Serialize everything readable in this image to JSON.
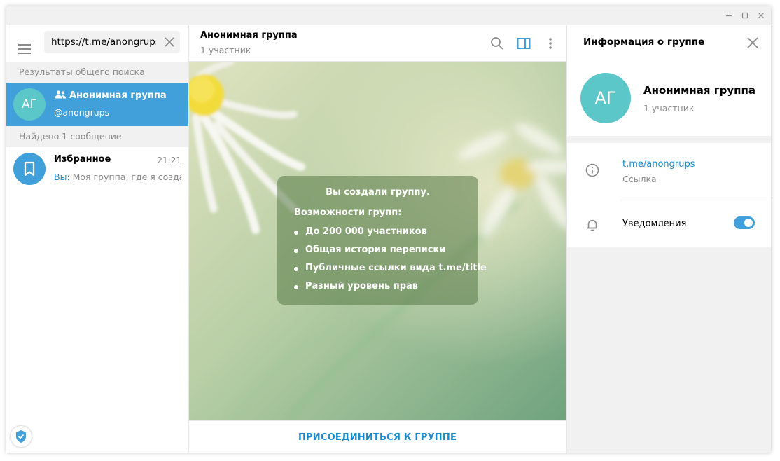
{
  "window": {
    "controls": [
      "minimize-icon",
      "maximize-icon",
      "close-icon"
    ]
  },
  "sidebar": {
    "search_value": "https://t.me/anongrups",
    "global_results_header": "Результаты общего поиска",
    "found_messages_header": "Найдено 1 сообщение",
    "results": [
      {
        "avatar_initials": "АГ",
        "avatar_color": "#5bc7c9",
        "name": "Анонимная группа",
        "username": "@anongrups",
        "icon": "group-icon"
      }
    ],
    "messages": [
      {
        "name": "Избранное",
        "time": "21:21",
        "sender": "Вы:",
        "preview": " Моя группа, где я созда...",
        "icon": "bookmark-icon",
        "avatar_color": "#419fd9"
      }
    ]
  },
  "chat": {
    "title": "Анонимная группа",
    "subtitle": "1 участник",
    "info_card": {
      "title": "Вы создали группу.",
      "subtitle": "Возможности групп:",
      "items": [
        "До 200 000 участников",
        "Общая история переписки",
        "Публичные ссылки вида t.me/title",
        "Разный уровень прав"
      ]
    },
    "join_button": "ПРИСОЕДИНИТЬСЯ К ГРУППЕ"
  },
  "info_panel": {
    "title": "Информация о группе",
    "avatar_initials": "АГ",
    "name": "Анонимная группа",
    "members": "1 участник",
    "link": "t.me/anongrups",
    "link_label": "Ссылка",
    "notifications_label": "Уведомления",
    "notifications_on": true
  },
  "colors": {
    "accent": "#419fd9",
    "link": "#168acd",
    "avatar": "#5bc7c9"
  }
}
